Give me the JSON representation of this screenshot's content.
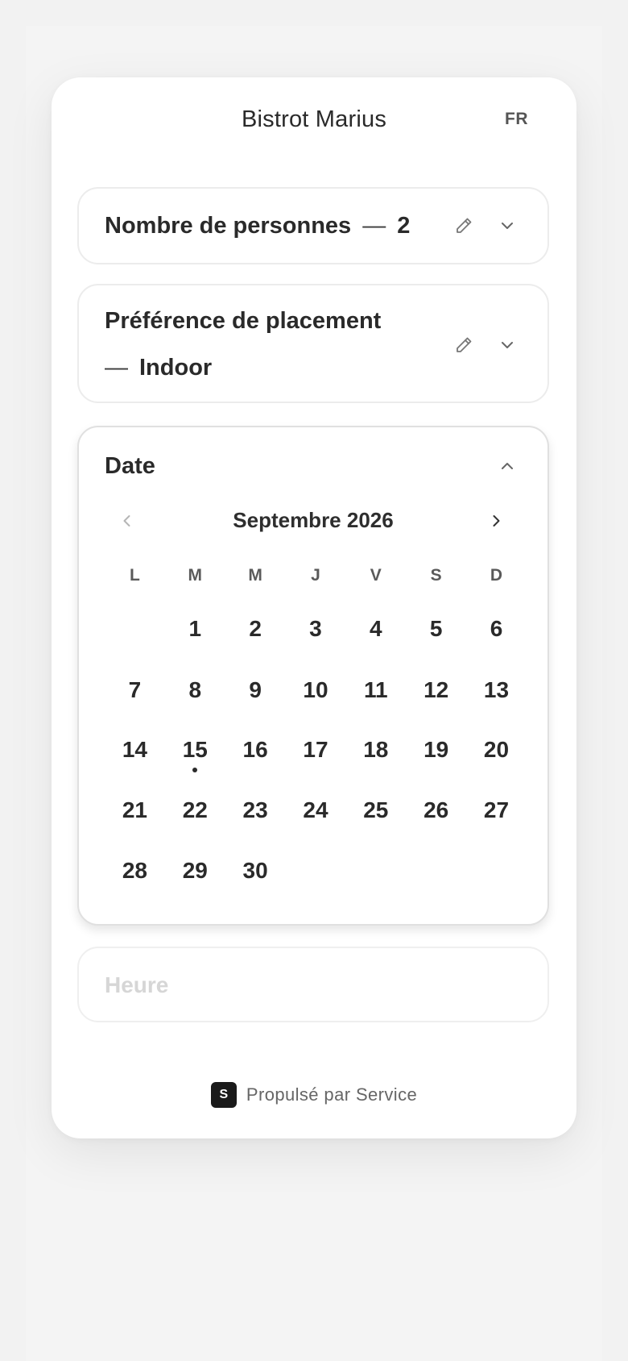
{
  "header": {
    "title": "Bistrot Marius",
    "language": "FR"
  },
  "persons": {
    "label": "Nombre de personnes",
    "separator": "—",
    "value": "2"
  },
  "placement": {
    "label": "Préférence de placement",
    "separator": "—",
    "value": "Indoor"
  },
  "date": {
    "label": "Date",
    "month_label": "Septembre 2026",
    "weekdays": [
      "L",
      "M",
      "M",
      "J",
      "V",
      "S",
      "D"
    ],
    "weeks": [
      [
        "",
        "1",
        "2",
        "3",
        "4",
        "5",
        "6"
      ],
      [
        "7",
        "8",
        "9",
        "10",
        "11",
        "12",
        "13"
      ],
      [
        "14",
        "15",
        "16",
        "17",
        "18",
        "19",
        "20"
      ],
      [
        "21",
        "22",
        "23",
        "24",
        "25",
        "26",
        "27"
      ],
      [
        "28",
        "29",
        "30",
        "",
        "",
        "",
        ""
      ]
    ],
    "today": "15"
  },
  "time": {
    "label": "Heure"
  },
  "footer": {
    "brand_letter": "S",
    "text": "Propulsé par Service"
  },
  "colors": {
    "text": "#2a2a2a",
    "muted": "#666666",
    "disabled": "#d6d6d6",
    "border": "#ececec",
    "brand": "#1a1a1a"
  },
  "icons": {
    "edit": "pencil-icon",
    "expand": "chevron-down-icon",
    "collapse": "chevron-up-icon",
    "prev": "chevron-left-icon",
    "next": "chevron-right-icon"
  }
}
